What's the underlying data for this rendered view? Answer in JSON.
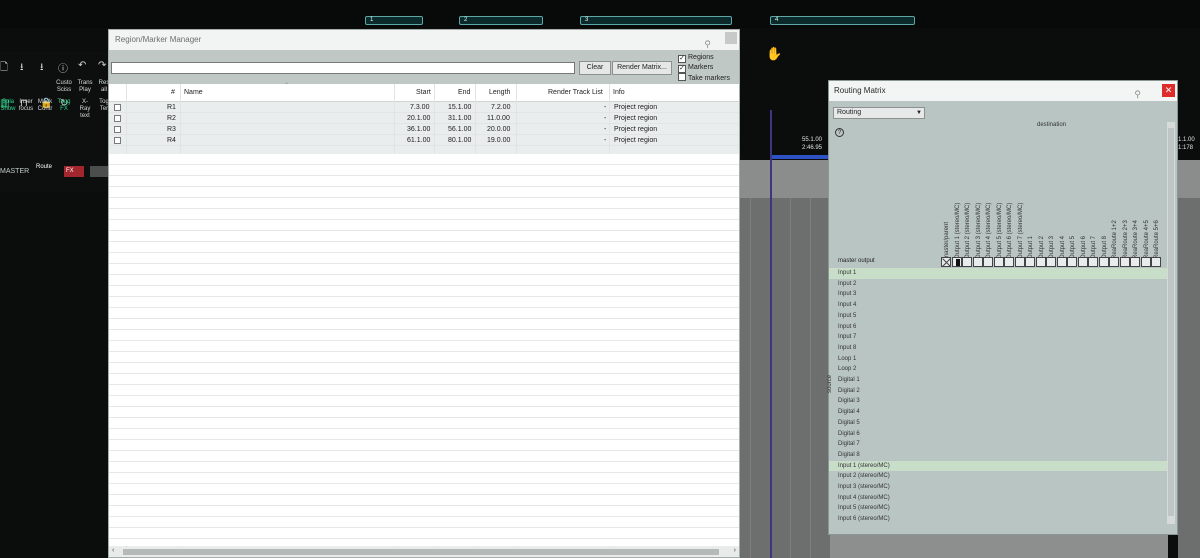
{
  "timeline": {
    "regions": [
      {
        "label": "1"
      },
      {
        "label": "2"
      },
      {
        "label": "3"
      },
      {
        "label": "4"
      }
    ],
    "time_a": "55.1.00",
    "time_b": "2:46.95",
    "time_c": "1.1.00",
    "time_d": "1:178"
  },
  "daw_toolbar": {
    "labels": [
      {
        "t": "Custo",
        "b": "Sciss"
      },
      {
        "t": "Trans",
        "b": "Play"
      },
      {
        "t": "Res",
        "b": "all"
      },
      {
        "t": "Spla",
        "b": "Show"
      },
      {
        "t": "Inser",
        "b": "focus"
      },
      {
        "t": "Mack",
        "b": "Contr"
      },
      {
        "t": "Togg",
        "b": "FX"
      },
      {
        "t": "X-Ray",
        "b": "text"
      },
      {
        "t": "Tog",
        "b": "Ter"
      }
    ],
    "master": "MASTER",
    "route": "Route",
    "fx": "FX"
  },
  "region_manager": {
    "title": "Region/Marker Manager",
    "filter_value": "",
    "clear_label": "Clear",
    "render_matrix_label": "Render Matrix...",
    "options": [
      {
        "label": "Regions",
        "checked": true
      },
      {
        "label": "Markers",
        "checked": true
      },
      {
        "label": "Take markers",
        "checked": false
      }
    ],
    "columns": {
      "num": "#",
      "name": "Name",
      "start": "Start",
      "end": "End",
      "length": "Length",
      "render": "Render Track List",
      "info": "Info"
    },
    "rows": [
      {
        "num": "R1",
        "name": "",
        "start": "7.3.00",
        "end": "15.1.00",
        "length": "7.2.00",
        "render": "-",
        "info": "Project region"
      },
      {
        "num": "R2",
        "name": "",
        "start": "20.1.00",
        "end": "31.1.00",
        "length": "11.0.00",
        "render": "-",
        "info": "Project region"
      },
      {
        "num": "R3",
        "name": "",
        "start": "36.1.00",
        "end": "56.1.00",
        "length": "20.0.00",
        "render": "-",
        "info": "Project region"
      },
      {
        "num": "R4",
        "name": "",
        "start": "61.1.00",
        "end": "80.1.00",
        "length": "19.0.00",
        "render": "-",
        "info": "Project region"
      }
    ]
  },
  "routing_matrix": {
    "title": "Routing Matrix",
    "mode": "Routing",
    "help": "?",
    "destination_label": "destination",
    "source_label": "source",
    "destinations": [
      "master/parent",
      "Output 1 (stereo/MC)",
      "Output 2 (stereo/MC)",
      "Output 3 (stereo/MC)",
      "Output 4 (stereo/MC)",
      "Output 5 (stereo/MC)",
      "Output 6 (stereo/MC)",
      "Output 7 (stereo/MC)",
      "Output 1",
      "Output 2",
      "Output 3",
      "Output 4",
      "Output 5",
      "Output 6",
      "Output 7",
      "Output 8",
      "ReaRoute 1+2",
      "ReaRoute 2+3",
      "ReaRoute 3+4",
      "ReaRoute 4+5",
      "ReaRoute 5+6"
    ],
    "master_output": "master output",
    "sources": [
      "Input 1",
      "Input 2",
      "Input 3",
      "Input 4",
      "Input 5",
      "Input 6",
      "Input 7",
      "Input 8",
      "Loop 1",
      "Loop 2",
      "Digital 1",
      "Digital 2",
      "Digital 3",
      "Digital 4",
      "Digital 5",
      "Digital 6",
      "Digital 7",
      "Digital 8",
      "Input 1 (stereo/MC)",
      "Input 2 (stereo/MC)",
      "Input 3 (stereo/MC)",
      "Input 4 (stereo/MC)",
      "Input 5 (stereo/MC)",
      "Input 6 (stereo/MC)"
    ],
    "highlighted_sources": [
      0,
      18
    ]
  }
}
